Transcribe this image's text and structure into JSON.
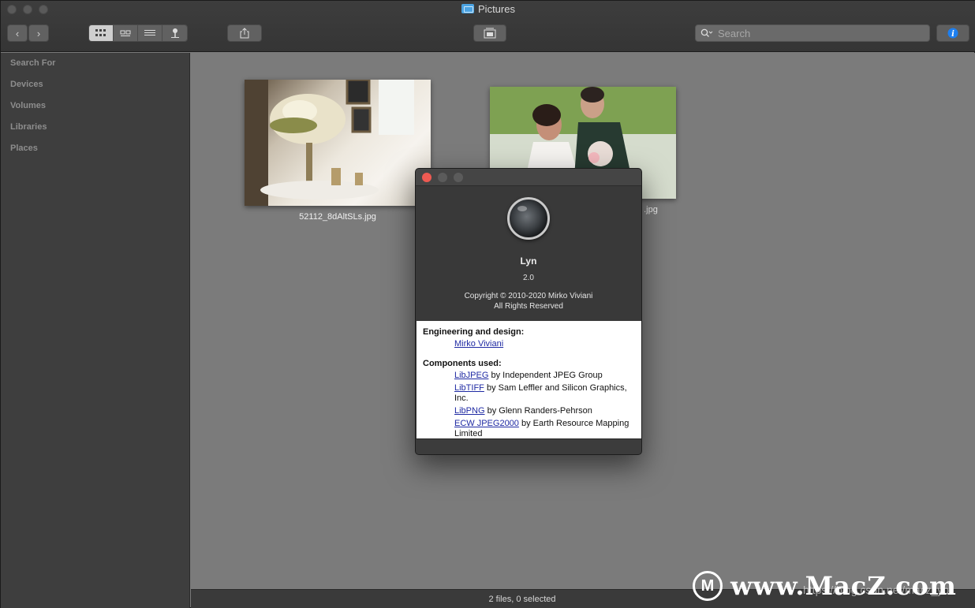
{
  "window": {
    "title": "Pictures"
  },
  "toolbar": {
    "search_placeholder": "Search",
    "view_modes": [
      "grid-view",
      "filmstrip-view",
      "list-view",
      "map-view"
    ],
    "active_view": "grid-view"
  },
  "sidebar": {
    "sections": [
      "Search For",
      "Devices",
      "Volumes",
      "Libraries",
      "Places"
    ]
  },
  "files": [
    {
      "name": "52112_8dAltSLs.jpg"
    },
    {
      "name": ".jpg"
    }
  ],
  "status": {
    "text": "2 files, 0 selected"
  },
  "about": {
    "app_name": "Lyn",
    "version": "2.0",
    "copyright": "Copyright © 2010-2020 Mirko Viviani",
    "rights": "All Rights Reserved",
    "engineering_heading": "Engineering and design:",
    "engineer": "Mirko Viviani",
    "components_heading": "Components used:",
    "components": [
      {
        "name": "LibJPEG",
        "by": " by Independent JPEG Group"
      },
      {
        "name": "LibTIFF",
        "by": " by Sam Leffler and Silicon Graphics, Inc."
      },
      {
        "name": "LibPNG",
        "by": " by Glenn Randers-Pehrson"
      },
      {
        "name": "ECW JPEG2000",
        "by": " by Earth Resource Mapping Limited"
      }
    ]
  },
  "watermark": {
    "logo_letter": "M",
    "text": "www.MacZ.com",
    "url": "https://blog.csdn.net/macz_yo"
  },
  "colors": {
    "close": "#ee5a52",
    "link": "#1f2aa3",
    "info_button": "#1d7ff0"
  }
}
